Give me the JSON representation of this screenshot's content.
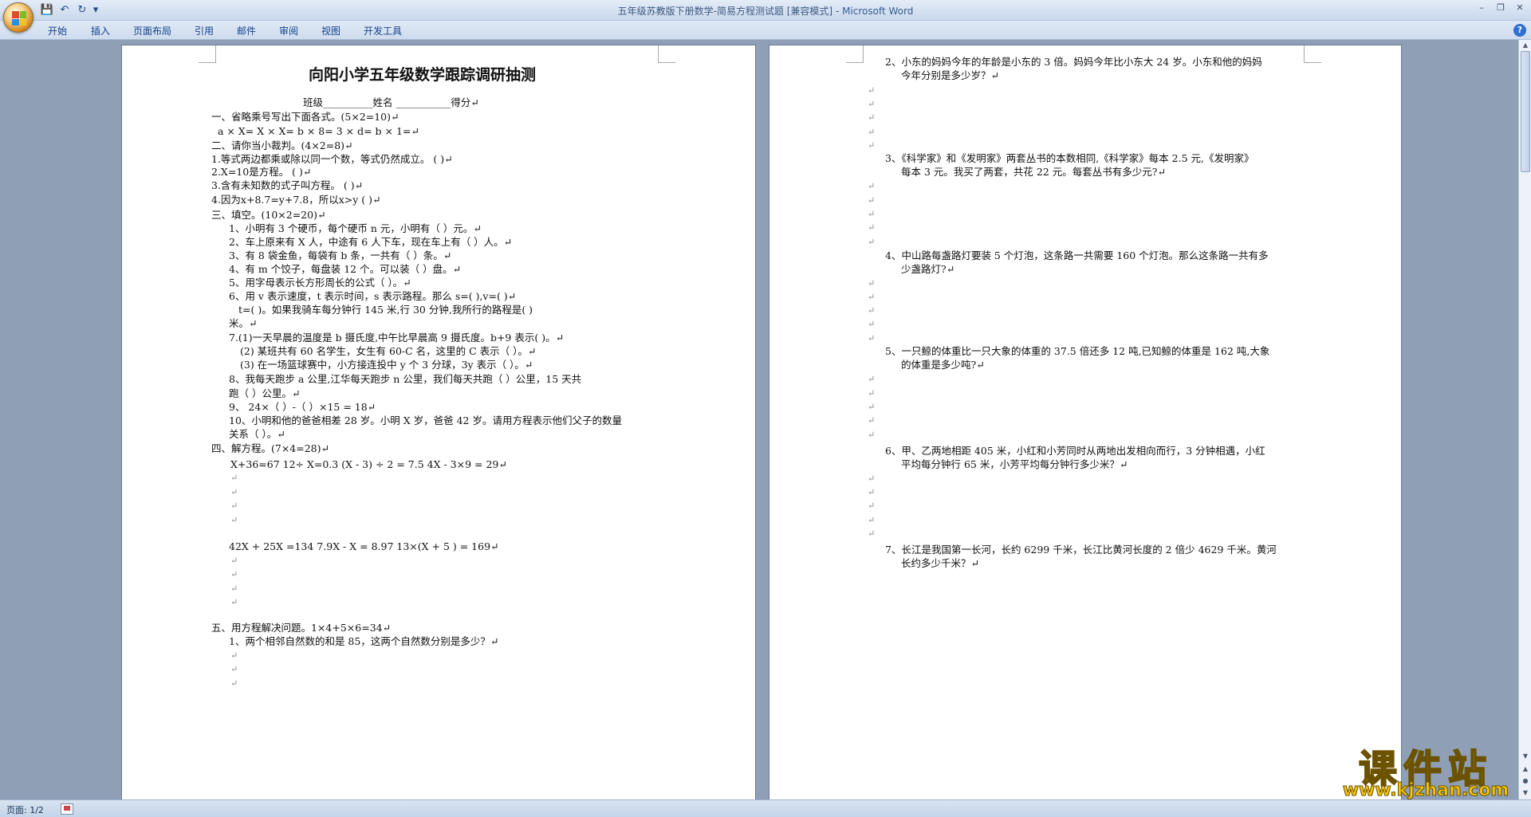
{
  "window": {
    "title": "五年级苏教版下册数学-简易方程测试题 [兼容模式]",
    "app_name": "Microsoft Word",
    "title_sep": " - "
  },
  "quick_access": {
    "save": "💾",
    "undo": "↶",
    "redo": "↻",
    "customize": "▾"
  },
  "ribbon_tabs": [
    "开始",
    "插入",
    "页面布局",
    "引用",
    "邮件",
    "审阅",
    "视图",
    "开发工具"
  ],
  "help": "?",
  "page1": {
    "title": "向阳小学五年级数学跟踪调研抽测",
    "lines": [
      "班级__________姓名 ___________得分↵",
      "一、省略乘号写出下面各式。(5×2=10)↵",
      "a × X=       X × X=       b × 8=      3 × d=         b × 1=↵",
      "二、请你当小裁判。(4×2=8)↵",
      "1.等式两边都乘或除以同一个数，等式仍然成立。   (      )↵",
      "2.X=10是方程。                                 (      )↵",
      "3.含有未知数的式子叫方程。                     (      )↵",
      "4.因为x+8.7=y+7.8，所以x>y              (      )↵",
      "三、填空。(10×2=20)↵",
      "1、小明有 3 个硬币，每个硬币 n 元，小明有（      ）元。↵",
      "2、车上原来有 X 人，中途有 6 人下车，现在车上有（      ）人。↵",
      "3、有 8 袋金鱼，每袋有 b 条，一共有（     ）条。↵",
      "4、有 m 个饺子，每盘装 12 个。可以装（      ）盘。↵",
      "5、用字母表示长方形周长的公式（                ）。↵",
      "6、用 v 表示速度，t 表示时间，s 表示路程。那么 s=(          ),v=(         )↵",
      "t=(          )。如果我骑车每分钟行 145 米,行 30 分钟,我所行的路程是(      )",
      "米。↵",
      "7.(1)一天早晨的温度是 b 摄氏度,中午比早晨高 9 摄氏度。b+9 表示(              )。↵",
      "(2) 某班共有 60 名学生，女生有 60-C 名，这里的 C 表示（             ）。↵",
      "(3) 在一场篮球赛中，小方接连投中 y 个 3 分球，3y 表示（                   ）。↵",
      "8、我每天跑步 a 公里,江华每天跑步 n 公里，我们每天共跑（        ）公里，15 天共",
      "跑（        ）公里。↵",
      "9、  24×（       ）-（      ）×15 = 18↵",
      "10、小明和他的爸爸相差 28 岁。小明 X 岁，爸爸 42 岁。请用方程表示他们父子的数量",
      "关系（                        ）。↵",
      "四、解方程。(7×4=28)↵",
      "X+36=67       12÷ X=0.3     (X - 3) ÷ 2 = 7.5      4X - 3×9 = 29↵",
      "↵",
      "↵",
      "↵",
      "↵",
      "42X + 25X =134     7.9X - X = 8.97           13×(X + 5 ) = 169↵",
      "↵",
      "↵",
      "↵",
      "↵",
      "五、用方程解决问题。1×4+5×6=34↵",
      "1、两个相邻自然数的和是 85，这两个自然数分别是多少？↵",
      "↵",
      "↵",
      "↵"
    ]
  },
  "page2": {
    "lines": [
      "2、小东的妈妈今年的年龄是小东的 3 倍。妈妈今年比小东大 24 岁。小东和他的妈妈",
      "今年分别是多少岁？↵",
      "↵",
      "↵",
      "↵",
      "↵",
      "↵",
      "3、《科学家》和《发明家》两套丛书的本数相同,《科学家》每本 2.5 元,《发明家》",
      "每本 3 元。我买了两套，共花 22 元。每套丛书有多少元?↵",
      "↵",
      "↵",
      "↵",
      "↵",
      "↵",
      "4、中山路每盏路灯要装 5 个灯泡，这条路一共需要 160 个灯泡。那么这条路一共有多",
      "少盏路灯?↵",
      "↵",
      "↵",
      "↵",
      "↵",
      "↵",
      "5、一只鲸的体重比一只大象的体重的 37.5 倍还多 12 吨,已知鲸的体重是 162 吨,大象",
      "的体重是多少吨?↵",
      "↵",
      "↵",
      "↵",
      "↵",
      "↵",
      "6、甲、乙两地相距 405 米，小红和小芳同时从两地出发相向而行，3 分钟相遇，小红",
      "平均每分钟行 65 米，小芳平均每分钟行多少米？↵",
      "↵",
      "↵",
      "↵",
      "↵",
      "↵",
      "7、长江是我国第一长河，长约 6299 千米，长江比黄河长度的 2 倍少 4629 千米。黄河",
      "长约多少千米？↵"
    ]
  },
  "status": {
    "page": "页面: 1/2"
  },
  "watermark": {
    "text": "课件站",
    "url": "www.kjzhan.com"
  }
}
